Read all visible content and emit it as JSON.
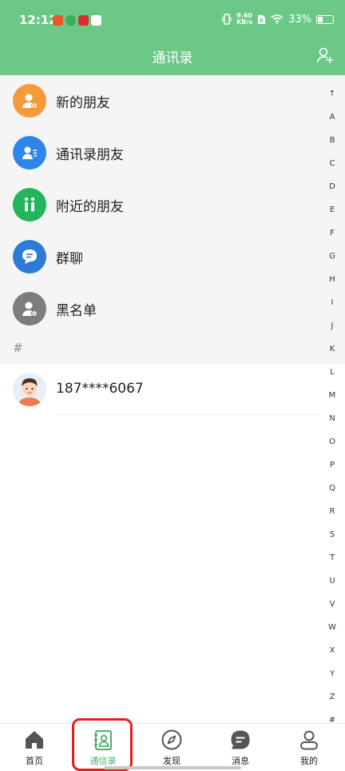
{
  "status_bar": {
    "time": "12:12",
    "net_speed_value": "9.60",
    "net_speed_unit": "KB/s",
    "battery": "33%"
  },
  "header": {
    "title": "通讯录"
  },
  "special_items": [
    {
      "label": "新的朋友",
      "icon": "new-friend-icon",
      "color": "#f59a38"
    },
    {
      "label": "通讯录朋友",
      "icon": "contacts-friend-icon",
      "color": "#2f86e8"
    },
    {
      "label": "附近的朋友",
      "icon": "nearby-icon",
      "color": "#22b55a"
    },
    {
      "label": "群聊",
      "icon": "group-chat-icon",
      "color": "#2c7bd8"
    },
    {
      "label": "黑名单",
      "icon": "blacklist-icon",
      "color": "#7d7d7d"
    }
  ],
  "section_letter": "#",
  "contacts": [
    {
      "name": "187****6067",
      "avatar": "avatar-boy"
    }
  ],
  "index_letters": [
    "↑",
    "A",
    "B",
    "C",
    "D",
    "E",
    "F",
    "G",
    "H",
    "I",
    "J",
    "K",
    "L",
    "M",
    "N",
    "O",
    "P",
    "Q",
    "R",
    "S",
    "T",
    "U",
    "V",
    "W",
    "X",
    "Y",
    "Z",
    "#"
  ],
  "tabbar": {
    "tabs": [
      {
        "label": "首页",
        "icon": "home-icon"
      },
      {
        "label": "通信录",
        "icon": "address-book-icon",
        "active": true
      },
      {
        "label": "发现",
        "icon": "compass-icon"
      },
      {
        "label": "消息",
        "icon": "message-icon"
      },
      {
        "label": "我的",
        "icon": "profile-icon"
      }
    ]
  },
  "colors": {
    "header": "#6cc886",
    "active_tab": "#4caf6a",
    "highlight": "#e02020"
  }
}
